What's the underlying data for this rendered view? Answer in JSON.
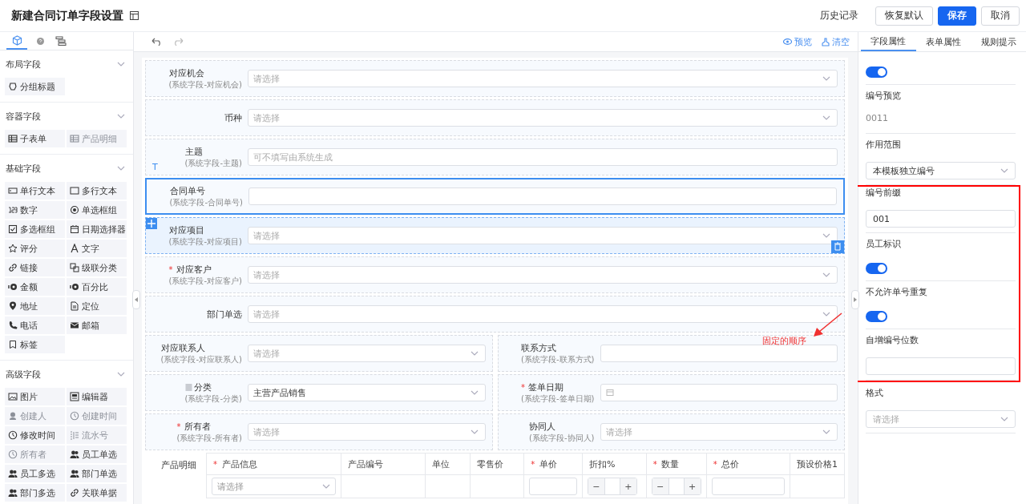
{
  "header": {
    "title": "新建合同订单字段设置",
    "actions": [
      {
        "label": "历史记录",
        "kind": "text"
      },
      {
        "label": "恢复默认",
        "kind": "default"
      },
      {
        "label": "保存",
        "kind": "primary"
      },
      {
        "label": "取消",
        "kind": "default"
      }
    ]
  },
  "palette": {
    "tabs": [
      {
        "kind": "cube",
        "selected": true
      },
      {
        "kind": "help",
        "selected": false
      },
      {
        "kind": "tree",
        "selected": false
      }
    ],
    "sections": [
      {
        "title": "布局字段",
        "expanded": true,
        "items": [
          {
            "label": "分组标题",
            "kind": "group",
            "disabled": false
          }
        ]
      },
      {
        "title": "容器字段",
        "expanded": true,
        "items": [
          {
            "label": "子表单",
            "kind": "table",
            "disabled": false
          },
          {
            "label": "产品明细",
            "kind": "table",
            "disabled": true
          }
        ]
      },
      {
        "title": "基础字段",
        "expanded": true,
        "items": [
          {
            "label": "单行文本",
            "kind": "input",
            "disabled": false
          },
          {
            "label": "多行文本",
            "kind": "textarea",
            "disabled": false
          },
          {
            "label": "数字",
            "kind": "number",
            "disabled": false
          },
          {
            "label": "单选框组",
            "kind": "radio",
            "disabled": false
          },
          {
            "label": "多选框组",
            "kind": "checkbox",
            "disabled": false
          },
          {
            "label": "日期选择器",
            "kind": "date",
            "disabled": false
          },
          {
            "label": "评分",
            "kind": "star",
            "disabled": false
          },
          {
            "label": "文字",
            "kind": "font",
            "disabled": false
          },
          {
            "label": "链接",
            "kind": "link",
            "disabled": false
          },
          {
            "label": "级联分类",
            "kind": "cascade",
            "disabled": false
          },
          {
            "label": "金额",
            "kind": "money",
            "disabled": false
          },
          {
            "label": "百分比",
            "kind": "money",
            "disabled": false
          },
          {
            "label": "地址",
            "kind": "pin",
            "disabled": false
          },
          {
            "label": "定位",
            "kind": "doc",
            "disabled": false
          },
          {
            "label": "电话",
            "kind": "phone",
            "disabled": false
          },
          {
            "label": "邮箱",
            "kind": "mail",
            "disabled": false
          },
          {
            "label": "标签",
            "kind": "tag",
            "disabled": false
          }
        ]
      },
      {
        "title": "高级字段",
        "expanded": true,
        "items": [
          {
            "label": "图片",
            "kind": "image",
            "disabled": false
          },
          {
            "label": "编辑器",
            "kind": "editor",
            "disabled": false
          },
          {
            "label": "创建人",
            "kind": "person",
            "disabled": true
          },
          {
            "label": "创建时间",
            "kind": "clock",
            "disabled": true
          },
          {
            "label": "修改时间",
            "kind": "clock",
            "disabled": false
          },
          {
            "label": "流水号",
            "kind": "serial",
            "disabled": true
          },
          {
            "label": "所有者",
            "kind": "clock",
            "disabled": true
          },
          {
            "label": "员工单选",
            "kind": "users",
            "disabled": false
          },
          {
            "label": "员工多选",
            "kind": "users",
            "disabled": false
          },
          {
            "label": "部门单选",
            "kind": "users",
            "disabled": false
          },
          {
            "label": "部门多选",
            "kind": "users",
            "disabled": false
          },
          {
            "label": "关联单据",
            "kind": "link",
            "disabled": false
          }
        ]
      }
    ]
  },
  "toolbar": {
    "actions": [
      {
        "label": "预览",
        "kind": "eye"
      },
      {
        "label": "清空",
        "kind": "clear"
      }
    ]
  },
  "form": {
    "rows": [
      {
        "fields": [
          {
            "label": "对应机会",
            "hint": "(系统字段-对应机会)",
            "kind": "select",
            "placeholder": "请选择",
            "selected": false,
            "hovered": false
          }
        ]
      },
      {
        "fields": [
          {
            "label": "币种",
            "kind": "select",
            "placeholder": "请选择",
            "selected": false,
            "hovered": false
          }
        ]
      },
      {
        "fields": [
          {
            "label": "主题",
            "hint": "(系统字段-主题)",
            "kind": "text",
            "placeholder": "可不填写由系统生成",
            "type_badge": "T",
            "selected": false,
            "hovered": false
          }
        ]
      },
      {
        "fields": [
          {
            "label": "合同单号",
            "hint": "(系统字段-合同单号)",
            "kind": "text",
            "selected": true,
            "hovered": false
          }
        ]
      },
      {
        "fields": [
          {
            "label": "对应项目",
            "hint": "(系统字段-对应项目)",
            "kind": "select",
            "placeholder": "请选择",
            "selected": false,
            "hovered": true
          }
        ]
      },
      {
        "fields": [
          {
            "label": "对应客户",
            "hint": "(系统字段-对应客户)",
            "kind": "select",
            "placeholder": "请选择",
            "required_mark": "*",
            "selected": false,
            "hovered": false
          }
        ]
      },
      {
        "fields": [
          {
            "label": "部门单选",
            "kind": "select",
            "placeholder": "请选择",
            "selected": false,
            "hovered": false
          }
        ]
      },
      {
        "fields": [
          {
            "label": "对应联系人",
            "hint": "(系统字段-对应联系人)",
            "kind": "select",
            "placeholder": "请选择",
            "selected": false,
            "hovered": false
          },
          {
            "label": "联系方式",
            "hint": "(系统字段-联系方式)",
            "kind": "text",
            "selected": false,
            "hovered": false
          }
        ]
      },
      {
        "fields": [
          {
            "label": "分类",
            "hint": "(系统字段-分类)",
            "kind": "select",
            "value": "主营产品销售",
            "label_icon": true,
            "selected": false,
            "hovered": false
          },
          {
            "label": "签单日期",
            "hint": "(系统字段-签单日期)",
            "kind": "date",
            "required_mark": "*",
            "selected": false,
            "hovered": false
          }
        ]
      },
      {
        "fields": [
          {
            "label": "所有者",
            "hint": "(系统字段-所有者)",
            "kind": "select",
            "placeholder": "请选择",
            "required_mark": "*",
            "selected": false,
            "hovered": false
          },
          {
            "label": "协同人",
            "hint": "(系统字段-协同人)",
            "kind": "select",
            "placeholder": "请选择",
            "selected": false,
            "hovered": false
          }
        ]
      }
    ],
    "product_table": {
      "label": "产品明细",
      "columns": [
        {
          "label": "产品信息",
          "required_mark": "*",
          "kind": "select",
          "placeholder": "请选择"
        },
        {
          "label": "产品编号",
          "kind": "empty"
        },
        {
          "label": "单位",
          "kind": "empty"
        },
        {
          "label": "零售价",
          "kind": "empty"
        },
        {
          "label": "单价",
          "required_mark": "*",
          "kind": "input"
        },
        {
          "label": "折扣%",
          "kind": "stepper",
          "minus": "−",
          "plus": "+"
        },
        {
          "label": "数量",
          "required_mark": "*",
          "kind": "stepper",
          "minus": "−",
          "plus": "+"
        },
        {
          "label": "总价",
          "required_mark": "*",
          "kind": "input"
        },
        {
          "label": "预设价格1",
          "kind": "empty"
        }
      ]
    }
  },
  "annotation": {
    "text": "固定的顺序"
  },
  "properties": {
    "tabs": [
      {
        "label": "字段属性",
        "selected": true
      },
      {
        "label": "表单属性",
        "selected": false
      },
      {
        "label": "规则提示",
        "selected": false
      }
    ],
    "items": [
      {
        "kind": "toggle",
        "on": true,
        "highlighted": false
      },
      {
        "kind": "readonly",
        "label": "编号预览",
        "value": "0011",
        "highlighted": false
      },
      {
        "kind": "select",
        "label": "作用范围",
        "value": "本模板独立编号",
        "highlighted": false
      },
      {
        "kind": "input",
        "label": "编号前缀",
        "value": "001",
        "highlighted": true
      },
      {
        "kind": "toggle",
        "label": "员工标识",
        "on": true,
        "highlighted": true
      },
      {
        "kind": "toggle",
        "label": "不允许单号重复",
        "on": true,
        "highlighted": true
      },
      {
        "kind": "input",
        "label": "自增编号位数",
        "highlighted": true
      },
      {
        "kind": "select",
        "label": "格式",
        "placeholder": "请选择",
        "highlighted": false
      }
    ]
  }
}
